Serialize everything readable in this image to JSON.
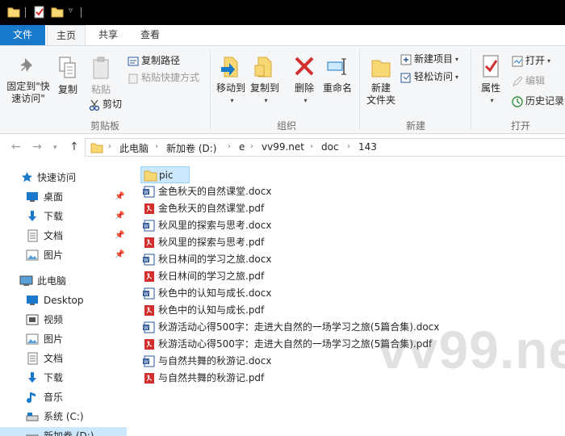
{
  "tabs": {
    "file": "文件",
    "home": "主页",
    "share": "共享",
    "view": "查看"
  },
  "clipboard": {
    "pin_label": "固定到\"快",
    "pin_label2": "速访问\"",
    "copy": "复制",
    "paste": "粘贴",
    "copy_path": "复制路径",
    "paste_shortcut": "粘贴快捷方式",
    "cut": "剪切",
    "group": "剪贴板"
  },
  "organize": {
    "move_to": "移动到",
    "copy_to": "复制到",
    "delete": "删除",
    "rename": "重命名",
    "group": "组织"
  },
  "new": {
    "new_folder": "新建",
    "new_folder2": "文件夹",
    "new_item": "新建项目",
    "easy_access": "轻松访问",
    "group": "新建"
  },
  "open": {
    "properties": "属性",
    "open": "打开",
    "edit": "编辑",
    "history": "历史记录",
    "group": "打开"
  },
  "breadcrumb": [
    "此电脑",
    "新加卷 (D:)",
    "e",
    "vv99.net",
    "doc",
    "143"
  ],
  "sidebar": {
    "quick_access": "快速访问",
    "desktop": "桌面",
    "downloads": "下载",
    "documents": "文档",
    "pictures": "图片",
    "this_pc": "此电脑",
    "desktop_en": "Desktop",
    "videos": "视频",
    "pictures2": "图片",
    "documents2": "文档",
    "downloads2": "下载",
    "music": "音乐",
    "system_c": "系统 (C:)",
    "new_vol_d": "新加卷 (D:)"
  },
  "files": [
    {
      "name": "pic",
      "type": "folder"
    },
    {
      "name": "金色秋天的自然课堂.docx",
      "type": "docx"
    },
    {
      "name": "金色秋天的自然课堂.pdf",
      "type": "pdf"
    },
    {
      "name": "秋风里的探索与思考.docx",
      "type": "docx"
    },
    {
      "name": "秋风里的探索与思考.pdf",
      "type": "pdf"
    },
    {
      "name": "秋日林间的学习之旅.docx",
      "type": "docx"
    },
    {
      "name": "秋日林间的学习之旅.pdf",
      "type": "pdf"
    },
    {
      "name": "秋色中的认知与成长.docx",
      "type": "docx"
    },
    {
      "name": "秋色中的认知与成长.pdf",
      "type": "pdf"
    },
    {
      "name": "秋游活动心得500字：走进大自然的一场学习之旅(5篇合集).docx",
      "type": "docx"
    },
    {
      "name": "秋游活动心得500字：走进大自然的一场学习之旅(5篇合集).pdf",
      "type": "pdf"
    },
    {
      "name": "与自然共舞的秋游记.docx",
      "type": "docx"
    },
    {
      "name": "与自然共舞的秋游记.pdf",
      "type": "pdf"
    }
  ],
  "watermark": "vv99.net",
  "colors": {
    "accent": "#1979ca",
    "folder": "#f8d775",
    "pdf_red": "#d32f2f",
    "word_blue": "#2b579a",
    "selection": "#cce8ff"
  }
}
